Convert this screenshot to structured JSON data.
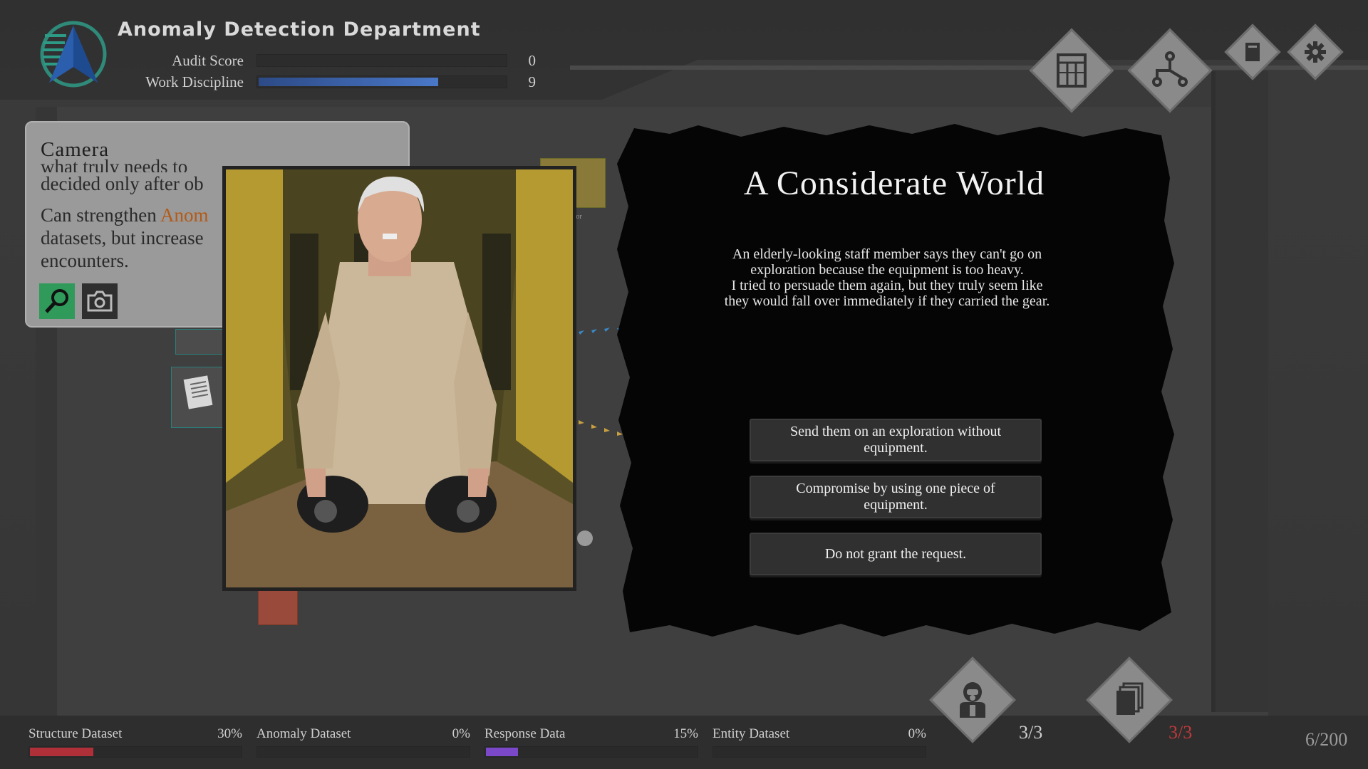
{
  "header": {
    "department": "Anomaly Detection Department",
    "stats": [
      {
        "label": "Audit Score",
        "value": "0",
        "fill": 0.0
      },
      {
        "label": "Work Discipline",
        "value": "9",
        "fill": 0.73
      }
    ]
  },
  "toolbar": {
    "buttons": [
      {
        "name": "documents-button",
        "icon": "document-grid-icon"
      },
      {
        "name": "flowchart-button",
        "icon": "flowchart-icon"
      },
      {
        "name": "notebook-button",
        "icon": "notebook-icon"
      },
      {
        "name": "settings-button",
        "icon": "gear-icon"
      }
    ]
  },
  "camera_card": {
    "title": "Camera",
    "desc_line1_partial": "what truly needs to",
    "desc_line2_partial": "decided only after ob",
    "desc_para2_a": "Can strengthen ",
    "desc_para2_highlight": "Anom",
    "desc_para2_b": "datasets, but increase",
    "desc_para2_c": "encounters.",
    "icons": [
      "magnifier-icon",
      "camera-icon"
    ]
  },
  "board": {
    "sector_label": "Sector"
  },
  "event": {
    "title": "A Considerate World",
    "text_lines": [
      "An elderly-looking staff member says they can't go on",
      "exploration because the equipment is too heavy.",
      "I tried to persuade them again, but they truly seem like",
      "they would fall over immediately if they carried the gear."
    ],
    "choices": [
      "Send them on an exploration without equipment.",
      "Compromise by using one piece of equipment.",
      "Do not grant the request."
    ]
  },
  "datasets": [
    {
      "label": "Structure Dataset",
      "percent": "30%",
      "fill": 0.3,
      "color": "#b0303a"
    },
    {
      "label": "Anomaly Dataset",
      "percent": "0%",
      "fill": 0.0,
      "color": "#8a4ad0"
    },
    {
      "label": "Response Data",
      "percent": "15%",
      "fill": 0.15,
      "color": "#7a48c8"
    },
    {
      "label": "Entity Dataset",
      "percent": "0%",
      "fill": 0.0,
      "color": "#4a78c8"
    }
  ],
  "counters": {
    "staff": "3/3",
    "cards": "3/3",
    "days": "6/200"
  },
  "colors": {
    "accent_blue": "#4a78c8",
    "highlight_orange": "#b35a18",
    "warning_red": "#c03a3a"
  }
}
